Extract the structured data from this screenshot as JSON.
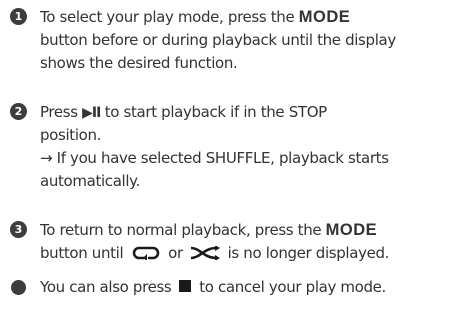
{
  "steps": [
    {
      "number": "1",
      "line1_pre": "To select your play mode, press the ",
      "line1_bold": "MODE",
      "line2": "button before or during playback until the display",
      "line3": "shows the desired function."
    },
    {
      "number": "2",
      "line1_pre": "Press ",
      "line1_icon": "▶II",
      "line1_post": " to start playback if in the STOP",
      "line2": "position.",
      "line3": "→ If you have selected SHUFFLE, playback starts",
      "line4": "automatically."
    },
    {
      "number": "3",
      "line1_pre": "To return to normal playback, press the ",
      "line1_bold": "MODE",
      "line2_pre": "button until ",
      "line2_mid": " or ",
      "line2_post": " is no longer displayed."
    }
  ],
  "note": {
    "pre": "You can also press ",
    "post": " to cancel your play mode."
  },
  "icons": {
    "number_badge": "filled-circle-number",
    "bullet": "filled-circle-bullet",
    "play_pause": "play-pause-icon",
    "repeat": "repeat-icon",
    "shuffle": "shuffle-icon",
    "stop": "stop-icon"
  },
  "colors": {
    "text": "#333333",
    "badge": "#3d3d3d"
  }
}
